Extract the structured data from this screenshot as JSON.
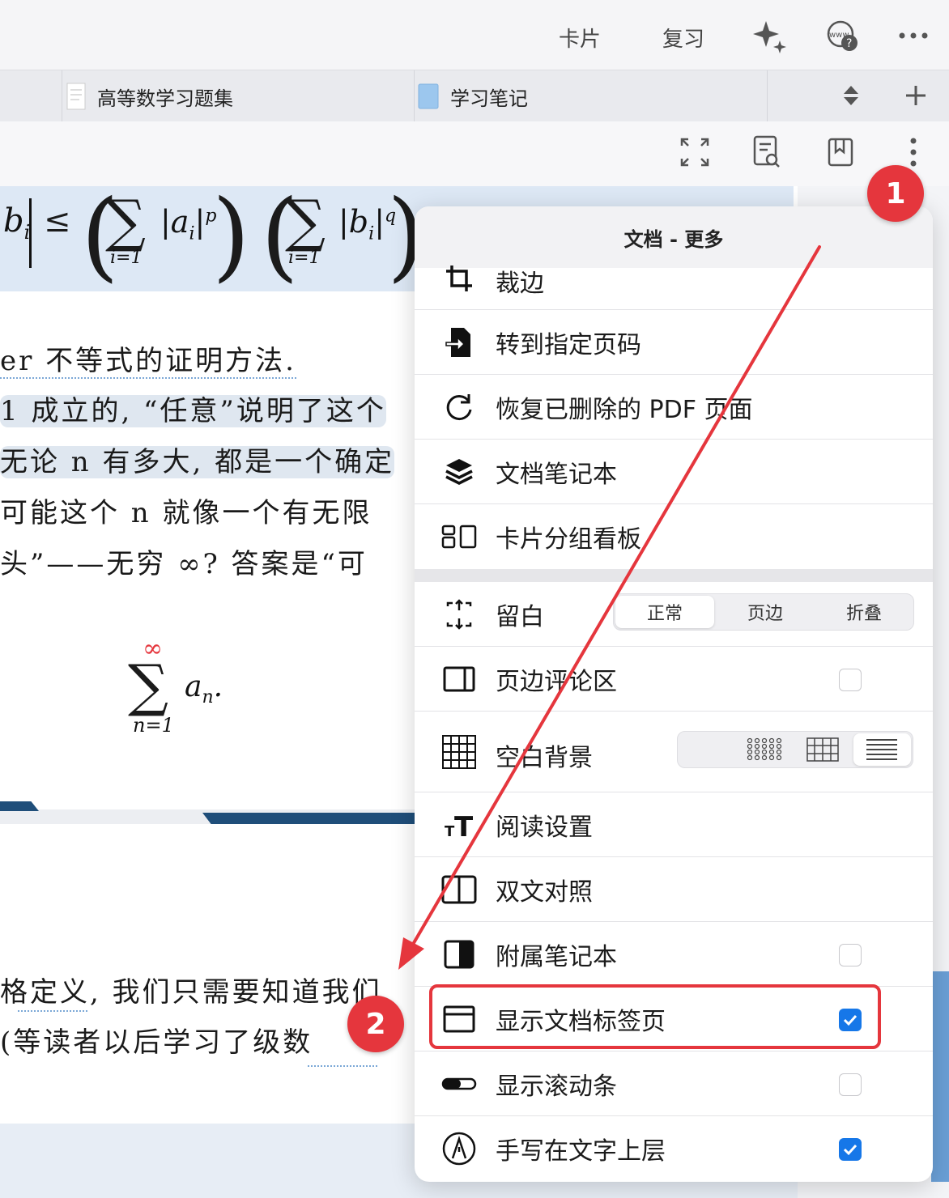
{
  "toolbar": {
    "cards_label": "卡片",
    "review_label": "复习",
    "icons": [
      "sparkle-icon",
      "web-help-icon",
      "more-horizontal-icon"
    ]
  },
  "tabs": [
    {
      "label": "高等数学习题集",
      "icon": "document-icon"
    },
    {
      "label": "学习笔记",
      "icon": "notebook-icon"
    }
  ],
  "doc_toolbar": {
    "icons": [
      "fullscreen-icon",
      "search-document-icon",
      "bookmark-icon",
      "more-vertical-icon"
    ]
  },
  "document": {
    "lines": [
      {
        "text": "er 不等式的证明方法."
      },
      {
        "text": "1 成立的, “任意”说明了这个"
      },
      {
        "text": "无论 n 有多大, 都是一个确定"
      },
      {
        "text": "可能这个 n 就像一个有无限"
      },
      {
        "text": "头”——无穷 ∞? 答案是“可"
      },
      {
        "text": "格定义, 我们只需要知道我们"
      },
      {
        "text": "(等读者以后学习了级数"
      }
    ],
    "sum_formula": {
      "upper": "∞",
      "lower": "n=1",
      "term": "a",
      "sub": "n",
      "tail": "."
    },
    "top_formula": {
      "left": "b",
      "sub": "i",
      "le": "≤",
      "i1": "i=1",
      "a": "|a",
      "p": "p",
      "b": "|b",
      "q": "q"
    }
  },
  "menu": {
    "title": "文档 - 更多",
    "items": [
      {
        "label": "裁边",
        "icon": "crop-icon"
      },
      {
        "label": "转到指定页码",
        "icon": "go-to-page-icon"
      },
      {
        "label": "恢复已删除的 PDF 页面",
        "icon": "restore-icon"
      },
      {
        "label": "文档笔记本",
        "icon": "layers-icon"
      },
      {
        "label": "卡片分组看板",
        "icon": "board-icon"
      }
    ],
    "margin_row": {
      "label": "留白",
      "icon": "margin-icon",
      "options": [
        "正常",
        "页边",
        "折叠"
      ],
      "selected": "正常"
    },
    "settings": [
      {
        "label": "页边评论区",
        "icon": "side-panel-icon",
        "checked": false
      },
      {
        "label": "空白背景",
        "icon": "grid-icon",
        "bg_options": [
          "dots-pattern-icon",
          "grid-pattern-icon",
          "lines-pattern-icon"
        ],
        "bg_selected": "lines-pattern-icon"
      },
      {
        "label": "阅读设置",
        "icon": "text-size-icon"
      },
      {
        "label": "双文对照",
        "icon": "split-view-icon"
      },
      {
        "label": "附属笔记本",
        "icon": "half-panel-icon",
        "checked": false
      },
      {
        "label": "显示文档标签页",
        "icon": "tab-window-icon",
        "checked": true
      },
      {
        "label": "显示滚动条",
        "icon": "scrollbar-icon",
        "checked": false
      },
      {
        "label": "手写在文字上层",
        "icon": "pen-icon",
        "checked": true
      }
    ]
  },
  "annotations": {
    "badge1": "1",
    "badge2": "2"
  },
  "colors": {
    "accent": "#1677e8",
    "annotation_red": "#e5363d",
    "formula_band": "#dde8f5"
  }
}
